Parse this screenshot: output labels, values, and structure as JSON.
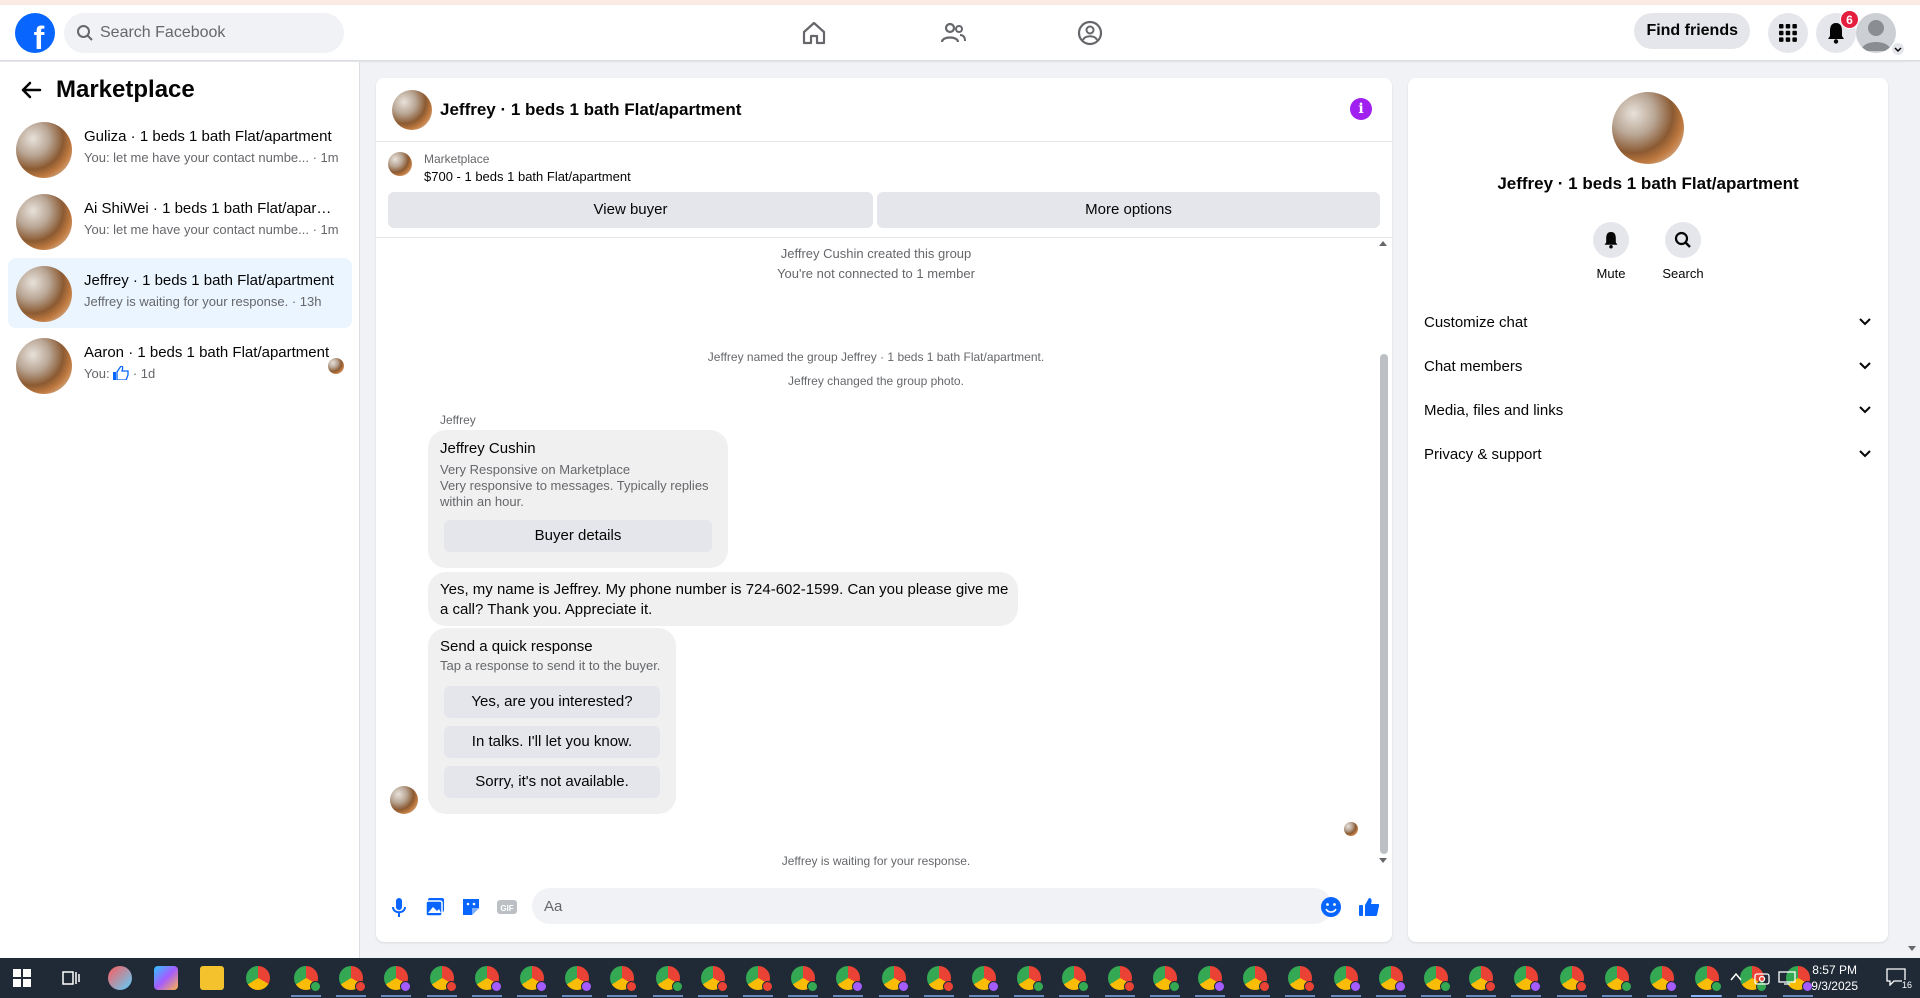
{
  "header": {
    "search_placeholder": "Search Facebook",
    "find_friends": "Find friends",
    "notifications_count": "6"
  },
  "sidebar": {
    "title": "Marketplace",
    "conversations": [
      {
        "title": "Guliza · 1 beds 1 bath Flat/apartment",
        "subtitle": "You: let me have your contact numbe... · 1m",
        "active": false
      },
      {
        "title": "Ai ShiWei · 1 beds 1 bath Flat/apartment",
        "subtitle": "You: let me have your contact numbe... · 1m",
        "active": false
      },
      {
        "title": "Jeffrey · 1 beds 1 bath Flat/apartment",
        "subtitle": "Jeffrey is waiting for your response. · 13h",
        "active": true
      },
      {
        "title": "Aaron · 1 beds 1 bath Flat/apartment",
        "subtitle_prefix": "You:",
        "subtitle_suffix": "· 1d",
        "active": false
      }
    ]
  },
  "chat": {
    "title": "Jeffrey · 1 beds 1 bath Flat/apartment",
    "marketplace_label": "Marketplace",
    "listing": "$700 - 1 beds 1 bath Flat/apartment",
    "view_buyer": "View buyer",
    "more_options": "More options",
    "system": {
      "created": "Jeffrey Cushin created this group",
      "not_connected": "You're not connected to 1 member",
      "named": "Jeffrey named the group Jeffrey · 1 beds 1 bath Flat/apartment.",
      "photo": "Jeffrey changed the group photo.",
      "waiting": "Jeffrey is waiting for your response."
    },
    "sender": "Jeffrey",
    "profile_card": {
      "name": "Jeffrey Cushin",
      "line1": "Very Responsive on Marketplace",
      "line2": "Very responsive to messages. Typically replies within an hour.",
      "button": "Buyer details"
    },
    "message": "Yes, my name is Jeffrey. My phone number is 724-602-1599. Can you please give me a call? Thank you. Appreciate it.",
    "quick_response": {
      "title": "Send a quick response",
      "subtitle": "Tap a response to send it to the buyer.",
      "options": [
        "Yes, are you interested?",
        "In talks. I'll let you know.",
        "Sorry, it's not available."
      ]
    },
    "composer_placeholder": "Aa"
  },
  "details": {
    "name": "Jeffrey · 1 beds 1 bath Flat/apartment",
    "mute": "Mute",
    "search": "Search",
    "sections": [
      "Customize chat",
      "Chat members",
      "Media, files and links",
      "Privacy & support"
    ]
  },
  "taskbar": {
    "time": "8:57 PM",
    "date": "9/3/2025",
    "notif_count": "16"
  },
  "colors": {
    "brand": "#0866ff",
    "info_accent": "#a020f0",
    "active_row": "#ebf5ff"
  }
}
